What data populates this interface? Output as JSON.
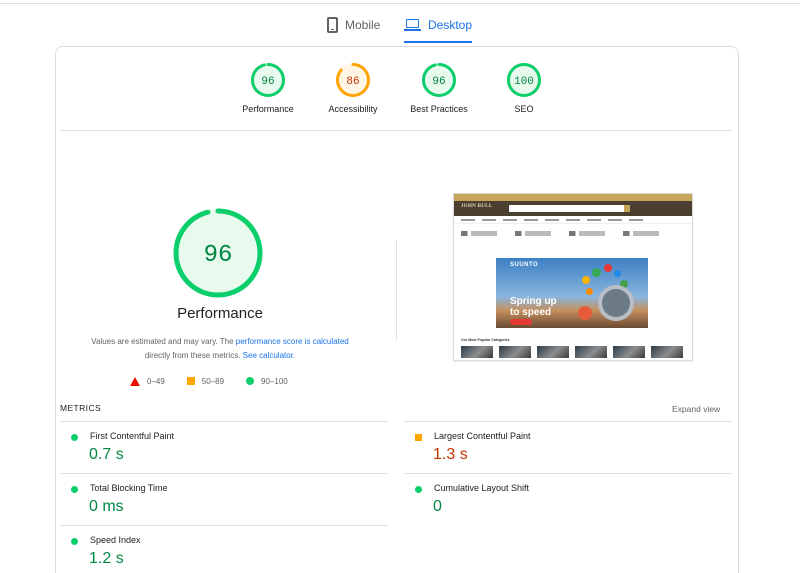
{
  "tabs": {
    "mobile": "Mobile",
    "desktop": "Desktop",
    "active": "desktop"
  },
  "categories": [
    {
      "label": "Performance",
      "score": 96,
      "rating": "pass"
    },
    {
      "label": "Accessibility",
      "score": 86,
      "rating": "average"
    },
    {
      "label": "Best Practices",
      "score": 96,
      "rating": "pass"
    },
    {
      "label": "SEO",
      "score": 100,
      "rating": "pass"
    }
  ],
  "performance": {
    "score": 96,
    "title": "Performance",
    "note_prefix": "Values are estimated and may vary. The ",
    "note_link1": "performance score is calculated",
    "note_middle": "directly from these metrics. ",
    "note_link2": "See calculator."
  },
  "legend": {
    "fail": "0–49",
    "average": "50–89",
    "pass": "90–100"
  },
  "screenshot": {
    "logo": "JOHN BULL",
    "brand": "SUUNTO",
    "tagline_line1": "Spring up",
    "tagline_line2": "to speed",
    "section": "Our Most Popular Categories"
  },
  "metrics": {
    "title": "METRICS",
    "expand": "Expand view",
    "items": [
      {
        "name": "First Contentful Paint",
        "value": "0.7 s",
        "rating": "pass"
      },
      {
        "name": "Largest Contentful Paint",
        "value": "1.3 s",
        "rating": "average"
      },
      {
        "name": "Total Blocking Time",
        "value": "0 ms",
        "rating": "pass"
      },
      {
        "name": "Cumulative Layout Shift",
        "value": "0",
        "rating": "pass"
      },
      {
        "name": "Speed Index",
        "value": "1.2 s",
        "rating": "pass"
      }
    ]
  },
  "colors": {
    "pass": "#0cce6b",
    "pass_text": "#018642",
    "average": "#ffa400",
    "average_text": "#c33300",
    "fail": "#eb0f00",
    "accent": "#1a73e8"
  }
}
